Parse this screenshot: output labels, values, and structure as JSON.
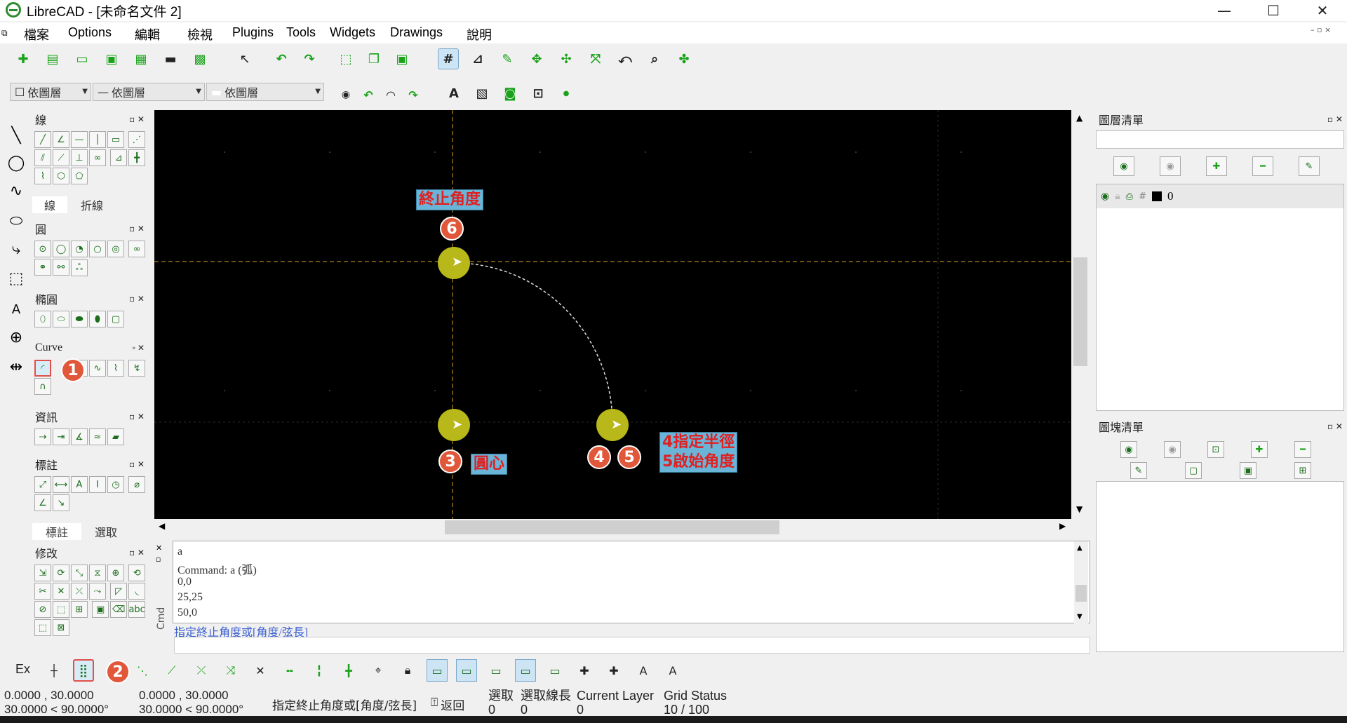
{
  "window": {
    "title": "LibreCAD - [未命名文件 2]",
    "minimize": "—",
    "maximize": "☐",
    "close": "✕"
  },
  "menu": [
    "檔案",
    "Options",
    "編輯",
    "檢視",
    "Plugins",
    "Tools",
    "Widgets",
    "Drawings",
    "說明"
  ],
  "combos": {
    "color": "依圖層",
    "linetype": "依圖層",
    "linewidth": "依圖層"
  },
  "panels": {
    "line": {
      "title": "線",
      "tab1": "線",
      "tab2": "折線"
    },
    "circle": {
      "title": "圓"
    },
    "ellipse": {
      "title": "橢圓"
    },
    "curve": {
      "title": "Curve"
    },
    "info": {
      "title": "資訊"
    },
    "dimension": {
      "title": "標註",
      "tab1": "標註",
      "tab2": "選取"
    },
    "modify": {
      "title": "修改"
    }
  },
  "annotations": {
    "end_angle": "終止角度",
    "center": "圓心",
    "radius": "4指定半徑",
    "start_angle": "5啟始角度",
    "badges": [
      "1",
      "2",
      "3",
      "4",
      "5",
      "6"
    ]
  },
  "command": {
    "history": [
      "a",
      "Command: a (弧)",
      "0,0",
      "25,25",
      "50,0"
    ],
    "prompt": "指定終止角度或[角度/弦長]",
    "side_label": "Cmd"
  },
  "layer_list": {
    "title": "圖層清單",
    "layer_name": "0"
  },
  "block_list": {
    "title": "圖塊清單"
  },
  "statusbar": {
    "ex": "Ex",
    "coord_abs_1": "0.0000 , 30.0000",
    "coord_abs_2": "30.0000 < 90.0000°",
    "coord_rel_1": "0.0000 , 30.0000",
    "coord_rel_2": "30.0000 < 90.0000°",
    "prompt": "指定終止角度或[角度/弦長]",
    "back": "返回",
    "selected_label": "選取",
    "selected_value": "0",
    "selected_len_label": "選取線長",
    "selected_len_value": "0",
    "current_layer_label": "Current Layer",
    "current_layer_value": "0",
    "grid_status_label": "Grid Status",
    "grid_status_value": "10 / 100"
  }
}
